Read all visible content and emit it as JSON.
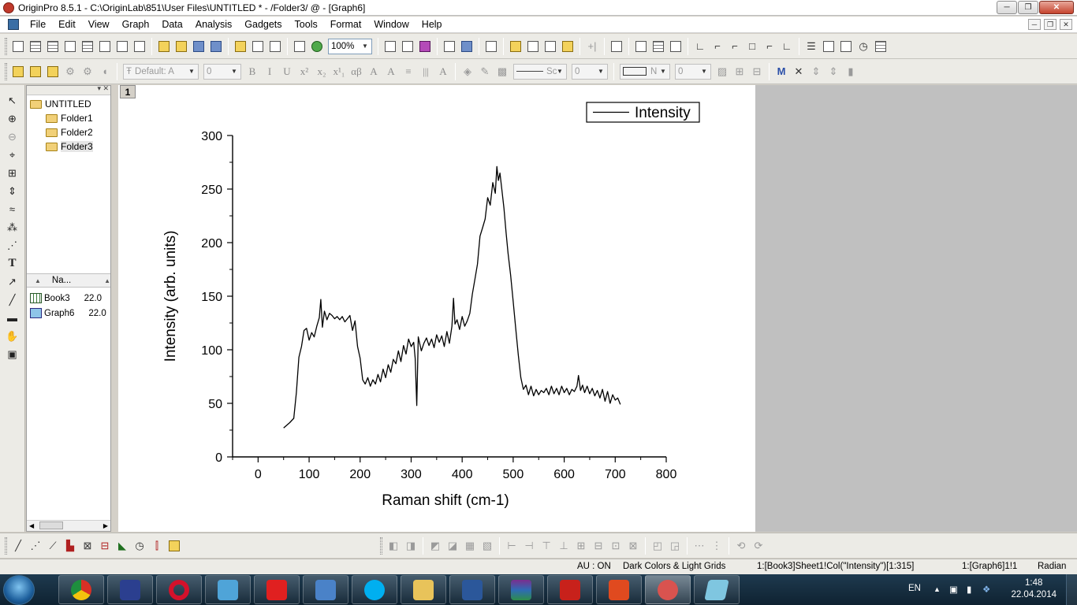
{
  "window": {
    "title": "OriginPro 8.5.1 - C:\\OriginLab\\851\\User Files\\UNTITLED * - /Folder3/ @ - [Graph6]",
    "minimize_glyph": "─",
    "maximize_glyph": "❐",
    "close_glyph": "✕"
  },
  "menu": {
    "items": [
      "File",
      "Edit",
      "View",
      "Graph",
      "Data",
      "Analysis",
      "Gadgets",
      "Tools",
      "Format",
      "Window",
      "Help"
    ]
  },
  "toolbar": {
    "zoom": "100%",
    "font_name": "Default: A",
    "font_size": "0",
    "format_buttons": [
      "B",
      "I",
      "U",
      "x²",
      "x₂",
      "x¹₁",
      "αβ",
      "A",
      "A",
      "≡",
      "|||",
      "A"
    ],
    "line_style": "Sc",
    "line_width": "0",
    "fill_label": "N",
    "fill_value": "0"
  },
  "project_explorer": {
    "root": "UNTITLED",
    "folders": [
      "Folder1",
      "Folder2",
      "Folder3"
    ],
    "selected_folder": "Folder3",
    "list_header": "Na...",
    "items": [
      {
        "name": "Book3",
        "date": "22.0",
        "kind": "workbook"
      },
      {
        "name": "Graph6",
        "date": "22.0",
        "kind": "graph"
      }
    ]
  },
  "graph": {
    "layer_label": "1",
    "legend": "Intensity",
    "xlabel": "Raman shift (cm-1)",
    "ylabel": "Intensity (arb. units)"
  },
  "chart_data": {
    "type": "line",
    "title": "",
    "xlabel": "Raman shift (cm-1)",
    "ylabel": "Intensity (arb. units)",
    "xlim": [
      -50,
      800
    ],
    "ylim": [
      0,
      300
    ],
    "xticks": [
      0,
      100,
      200,
      300,
      400,
      500,
      600,
      700,
      800
    ],
    "yticks": [
      0,
      50,
      100,
      150,
      200,
      250,
      300
    ],
    "grid": false,
    "legend_position": "top-right",
    "series": [
      {
        "name": "Intensity",
        "color": "#000000",
        "x": [
          50,
          62,
          70,
          75,
          80,
          85,
          90,
          95,
          100,
          105,
          110,
          115,
          120,
          123,
          126,
          130,
          135,
          140,
          145,
          150,
          155,
          160,
          165,
          170,
          175,
          180,
          185,
          190,
          195,
          200,
          205,
          210,
          215,
          220,
          225,
          230,
          235,
          240,
          245,
          250,
          255,
          260,
          265,
          270,
          275,
          280,
          285,
          290,
          295,
          300,
          305,
          308,
          311,
          314,
          320,
          325,
          330,
          335,
          340,
          345,
          350,
          355,
          360,
          365,
          370,
          375,
          380,
          383,
          386,
          390,
          395,
          400,
          405,
          410,
          415,
          420,
          425,
          430,
          435,
          440,
          445,
          450,
          455,
          460,
          465,
          468,
          471,
          474,
          478,
          482,
          486,
          490,
          495,
          500,
          505,
          510,
          515,
          520,
          525,
          530,
          535,
          540,
          545,
          550,
          555,
          560,
          565,
          570,
          575,
          580,
          585,
          590,
          595,
          600,
          605,
          610,
          615,
          620,
          625,
          628,
          632,
          636,
          640,
          645,
          650,
          655,
          660,
          665,
          670,
          675,
          680,
          685,
          690,
          695,
          700,
          705,
          710
        ],
        "y": [
          27,
          32,
          36,
          60,
          93,
          103,
          118,
          120,
          109,
          116,
          112,
          122,
          130,
          147,
          121,
          136,
          128,
          134,
          132,
          129,
          131,
          128,
          131,
          126,
          129,
          132,
          118,
          127,
          103,
          92,
          72,
          68,
          74,
          66,
          72,
          68,
          77,
          70,
          82,
          74,
          86,
          79,
          91,
          87,
          99,
          89,
          104,
          96,
          110,
          103,
          107,
          92,
          48,
          112,
          99,
          106,
          111,
          104,
          110,
          102,
          114,
          107,
          113,
          103,
          117,
          106,
          122,
          148,
          124,
          128,
          119,
          131,
          122,
          127,
          134,
          152,
          166,
          180,
          206,
          214,
          222,
          242,
          235,
          256,
          246,
          271,
          258,
          265,
          249,
          232,
          210,
          190,
          170,
          145,
          120,
          95,
          74,
          63,
          67,
          58,
          66,
          57,
          63,
          58,
          62,
          60,
          64,
          58,
          66,
          59,
          64,
          58,
          66,
          60,
          64,
          58,
          63,
          61,
          66,
          76,
          62,
          67,
          60,
          66,
          59,
          64,
          57,
          62,
          55,
          63,
          52,
          61,
          50,
          58,
          53,
          55,
          49
        ]
      }
    ]
  },
  "bottom_toolbar": {
    "icons": [
      "line-icon",
      "scatter-icon",
      "line-symbol-icon",
      "column-icon",
      "contour-icon",
      "box-icon",
      "area-icon",
      "polar-icon",
      "hilo-icon",
      "template-icon"
    ]
  },
  "status": {
    "au": "AU : ON",
    "theme": "Dark Colors & Light Grids",
    "active_cell": "1:[Book3]Sheet1!Col(\"Intensity\")[1:315]",
    "active_graph": "1:[Graph6]1!1",
    "angle_unit": "Radian"
  },
  "taskbar": {
    "language": "EN",
    "time": "1:48",
    "date": "22.04.2014",
    "apps": [
      "chrome-icon",
      "save-icon",
      "opera-icon",
      "music-icon",
      "yandex-icon",
      "volume-app-icon",
      "skype-icon",
      "explorer-icon",
      "word-icon",
      "winrar-icon",
      "acrobat-icon",
      "origin-icon",
      "origin-active-icon",
      "notes-icon"
    ]
  },
  "colors": {
    "plot_line": "#000000",
    "page_background": "#ffffff",
    "workspace": "#c0c0c0",
    "taskbar": "#1e3a4f"
  }
}
